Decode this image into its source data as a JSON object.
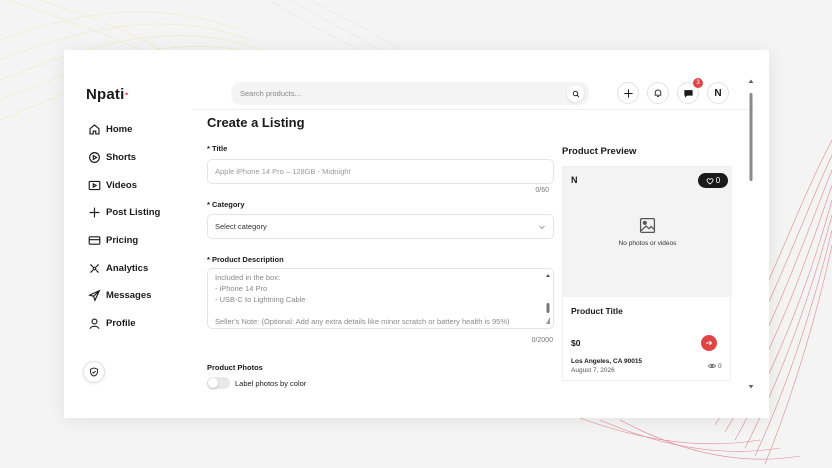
{
  "app": {
    "logo": "Npati",
    "logo_dot": "·"
  },
  "sidebar": {
    "items": [
      {
        "label": "Home",
        "icon": "home-icon"
      },
      {
        "label": "Shorts",
        "icon": "play-circle-icon"
      },
      {
        "label": "Videos",
        "icon": "video-icon"
      },
      {
        "label": "Post Listing",
        "icon": "plus-icon"
      },
      {
        "label": "Pricing",
        "icon": "credit-card-icon"
      },
      {
        "label": "Analytics",
        "icon": "analytics-icon"
      },
      {
        "label": "Messages",
        "icon": "send-icon"
      },
      {
        "label": "Profile",
        "icon": "user-icon"
      }
    ]
  },
  "header": {
    "search_placeholder": "Search products...",
    "notification_badge": "3",
    "avatar_initial": "N"
  },
  "form": {
    "page_title": "Create a Listing",
    "title_label": "* Title",
    "title_placeholder": "Apple iPhone 14 Pro – 128GB - Midnight",
    "title_counter": "0/60",
    "category_label": "* Category",
    "category_value": "Select category",
    "description_label": "* Product Description",
    "description_lines": [
      "Included in the box:",
      "- iPhone 14 Pro",
      "- USB-C to Lightning Cable",
      "",
      "Seller's Note: (Optional: Add any extra details like minor scratch or battery health is 95%)"
    ],
    "description_counter": "0/2000",
    "photos_label": "Product Photos",
    "toggle_label": "Label photos by color"
  },
  "preview": {
    "title": "Product Preview",
    "seller_initial": "N",
    "likes": "0",
    "no_media": "No photos or videos",
    "product_title": "Product Title",
    "price": "$0",
    "location": "Los Angeles, CA 90015",
    "date": "August 7, 2026",
    "views": "0"
  },
  "colors": {
    "accent": "#e04545",
    "dark": "#1a1a1a"
  }
}
